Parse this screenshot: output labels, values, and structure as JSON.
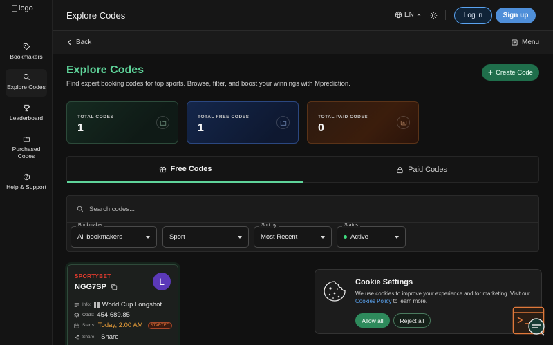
{
  "logo": {
    "alt": "logo"
  },
  "sidebar": {
    "items": [
      {
        "label": "Bookmakers",
        "icon": "tag-icon"
      },
      {
        "label": "Explore Codes",
        "icon": "search-icon",
        "active": true
      },
      {
        "label": "Leaderboard",
        "icon": "trophy-icon"
      },
      {
        "label": "Purchased Codes",
        "icon": "folder-icon"
      },
      {
        "label": "Help & Support",
        "icon": "help-icon"
      }
    ]
  },
  "header": {
    "title": "Explore Codes",
    "language": "EN",
    "login_label": "Log in",
    "signup_label": "Sign up"
  },
  "subbar": {
    "back_label": "Back",
    "menu_label": "Menu"
  },
  "main": {
    "title": "Explore Codes",
    "subtitle": "Find expert booking codes for top sports. Browse, filter, and boost your winnings with Mprediction.",
    "create_label": "Create Code",
    "stats": [
      {
        "label": "TOTAL CODES",
        "value": "1"
      },
      {
        "label": "TOTAL FREE CODES",
        "value": "1"
      },
      {
        "label": "TOTAL PAID CODES",
        "value": "0"
      }
    ],
    "tabs": [
      {
        "label": "Free Codes",
        "active": true
      },
      {
        "label": "Paid Codes",
        "active": false
      }
    ],
    "search_placeholder": "Search codes...",
    "filters": {
      "bookmaker": {
        "legend": "Bookmaker",
        "value": "All bookmakers"
      },
      "sport": {
        "legend": "",
        "value": "Sport"
      },
      "sort": {
        "legend": "Sort by",
        "value": "Most Recent"
      },
      "status": {
        "legend": "Status",
        "value": "Active",
        "status_color": "#3fdc7f"
      }
    }
  },
  "card": {
    "bookmaker": "SPORTYBET",
    "code": "NGG7SP",
    "avatar_initial": "L",
    "info_key": "Info:",
    "info_value": "World Cup Longshot ...",
    "odds_key": "Odds:",
    "odds_value": "454,689.85",
    "starts_key": "Starts:",
    "starts_value": "Today, 2:00 AM",
    "started_badge": "STARTED",
    "share_key": "Share:",
    "share_value": "Share"
  },
  "cookie": {
    "title": "Cookie Settings",
    "text": "We use cookies to improve your experience and for marketing. Visit our",
    "link": "Cookies Policy",
    "text_after": "to learn more.",
    "allow_label": "Allow all",
    "reject_label": "Reject all"
  },
  "colors": {
    "accent_green": "#5fd49a",
    "primary_blue": "#4f8fd9",
    "brand_red": "#e23b2e"
  }
}
